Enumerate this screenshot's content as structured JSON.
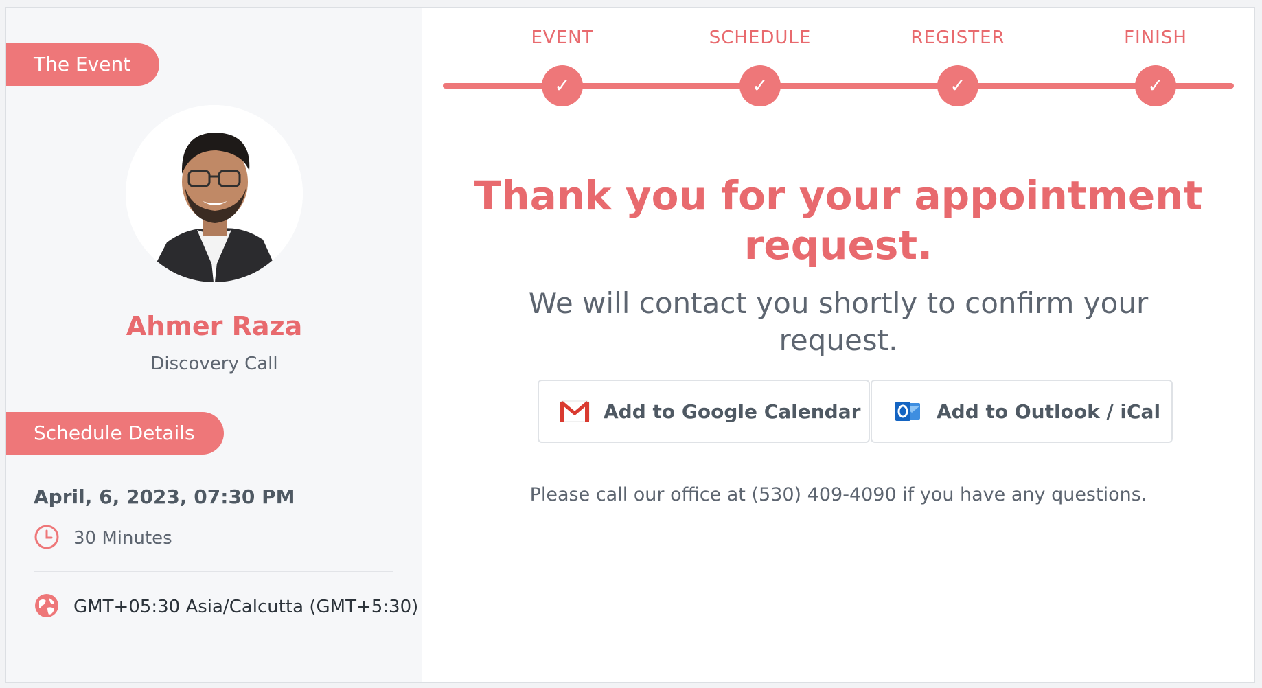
{
  "sidebar": {
    "event_pill": "The Event",
    "host_name": "Ahmer Raza",
    "event_type": "Discovery Call",
    "schedule_pill": "Schedule Details",
    "date_time": "April, 6, 2023, 07:30 PM",
    "duration": "30 Minutes",
    "timezone": "GMT+05:30 Asia/Calcutta (GMT+5:30)"
  },
  "steps": [
    {
      "label": "EVENT",
      "check": "✓"
    },
    {
      "label": "SCHEDULE",
      "check": "✓"
    },
    {
      "label": "REGISTER",
      "check": "✓"
    },
    {
      "label": "FINISH",
      "check": "✓"
    }
  ],
  "main": {
    "thanks_heading": "Thank you for your appointment request.",
    "confirm_message": "We will contact you shortly to confirm your request.",
    "google_button": "Add to Google Calendar",
    "outlook_button": "Add to Outlook / iCal",
    "contact_note": "Please call our office at (530) 409-4090 if you have any questions."
  },
  "colors": {
    "accent": "#ee7779",
    "accent_text": "#e86a6e",
    "body_text": "#5d6570"
  },
  "icons": {
    "clock": "clock-icon",
    "globe": "globe-icon",
    "gmail": "gmail-icon",
    "outlook": "outlook-icon",
    "check": "check-icon"
  }
}
